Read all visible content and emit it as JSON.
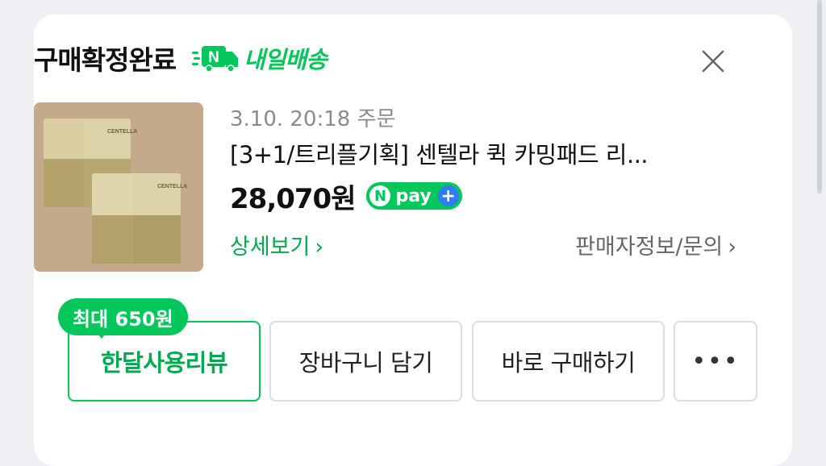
{
  "header": {
    "status": "구매확정완료",
    "delivery_badge": "N",
    "delivery_label": "내일배송"
  },
  "product": {
    "order_date": "3.10. 20:18 주문",
    "name": "[3+1/트리플기획] 센텔라 퀵 카밍패드 리...",
    "price": "28,070원",
    "thumbnail_brand": "CENTELLA"
  },
  "npay": {
    "n": "N",
    "label": "pay",
    "plus": "+"
  },
  "links": {
    "detail": "상세보기",
    "seller": "판매자정보/문의"
  },
  "reward_badge": "최대 650원",
  "buttons": {
    "review": "한달사용리뷰",
    "cart": "장바구니 담기",
    "buy": "바로 구매하기",
    "more": "•••"
  },
  "colors": {
    "accent_green": "#03c75a",
    "link_green": "#03a94f",
    "npay_plus_blue": "#2f7df6"
  }
}
